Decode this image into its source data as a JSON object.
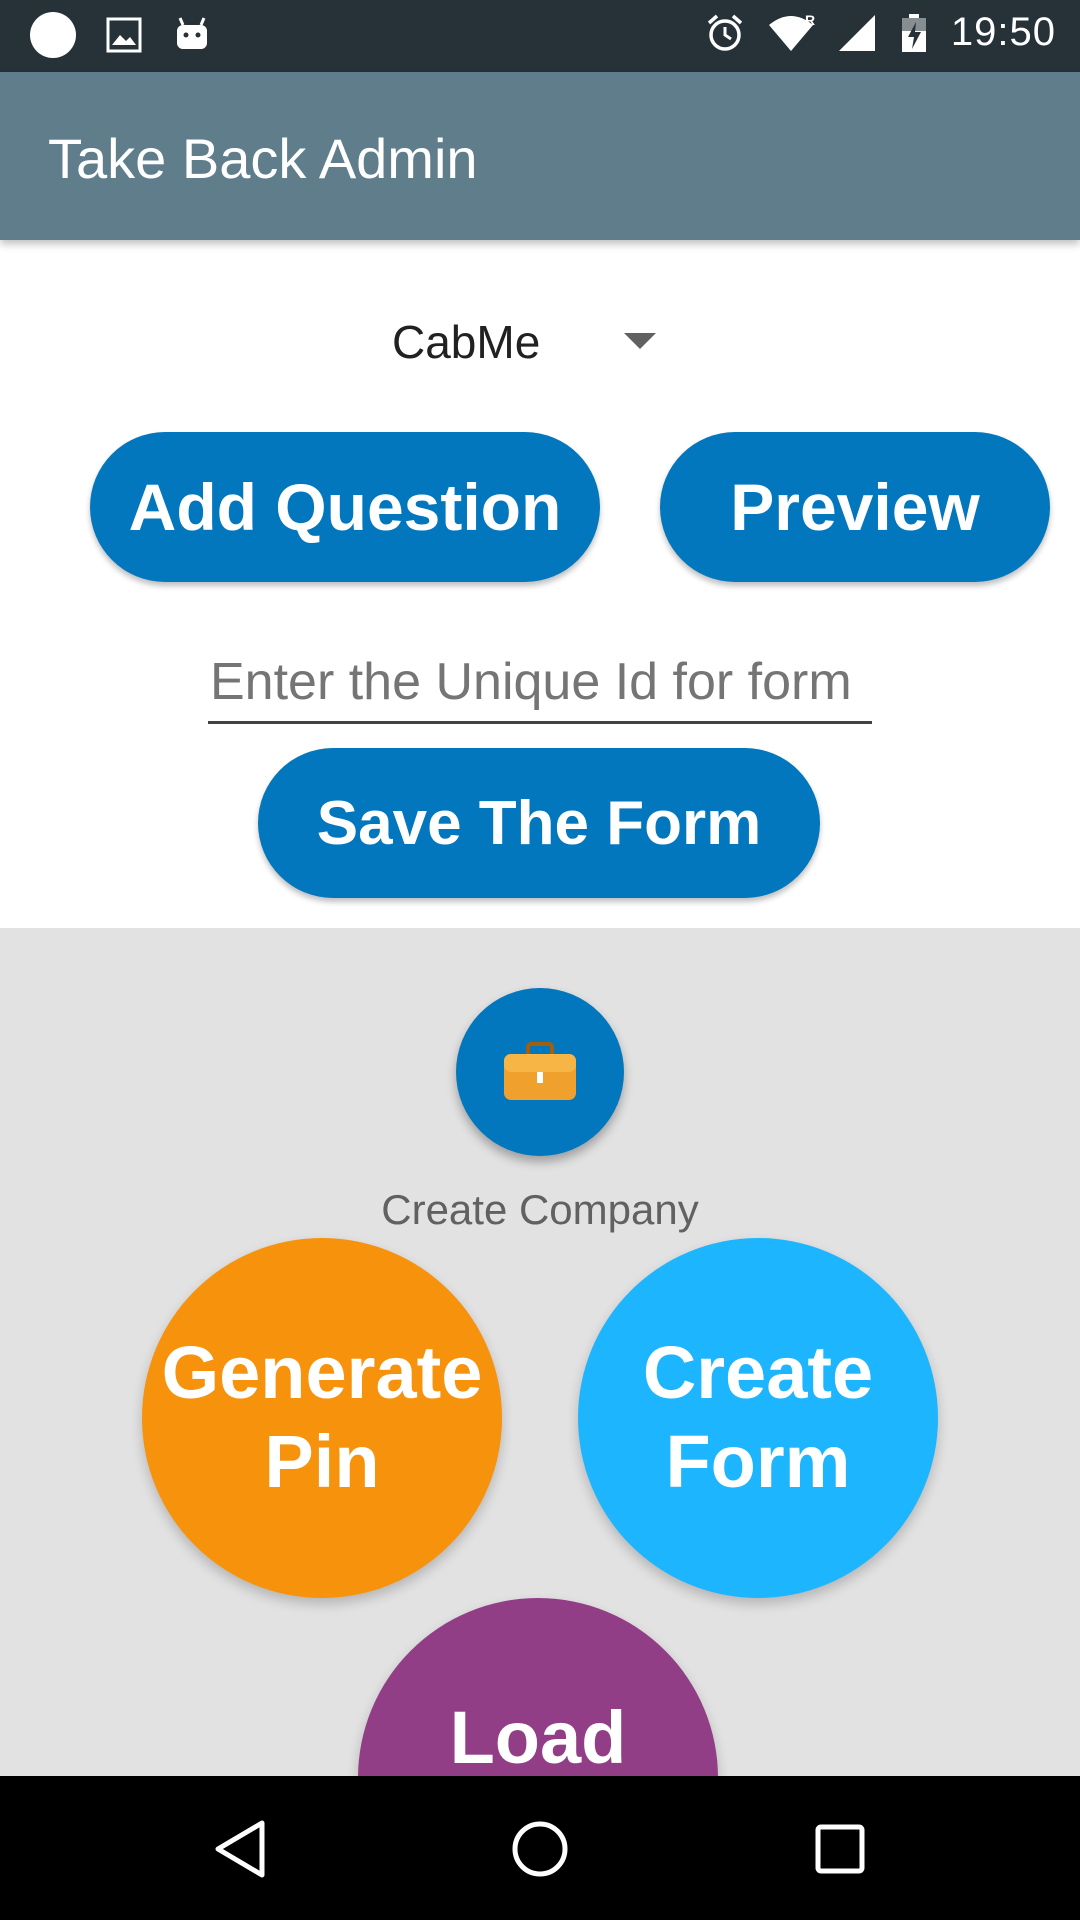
{
  "status_bar": {
    "time": "19:50",
    "left_icons": [
      "circle-notification-icon",
      "image-icon",
      "android-icon"
    ],
    "right_icons": [
      "alarm-icon",
      "wifi-icon",
      "signal-icon",
      "battery-charging-icon"
    ],
    "roaming_label": "R"
  },
  "app_bar": {
    "title": "Take Back Admin",
    "color": "#607d8b"
  },
  "company_dropdown": {
    "selected": "CabMe"
  },
  "buttons": {
    "add_question": "Add Question",
    "preview": "Preview",
    "save_form": "Save The Form",
    "color": "#0277bd"
  },
  "unique_id_input": {
    "placeholder": "Enter the Unique Id for form",
    "value": ""
  },
  "menu": {
    "fab_icon": "briefcase-icon",
    "fab_label": "Create Company",
    "items": [
      {
        "label_line1": "Generate",
        "label_line2": "Pin",
        "color": "#f7920c"
      },
      {
        "label_line1": "Create",
        "label_line2": "Form",
        "color": "#1eb5ff"
      },
      {
        "label_line1": "Load",
        "color": "#913e87"
      }
    ]
  },
  "nav_bar": {
    "icons": [
      "back-icon",
      "home-icon",
      "recents-icon"
    ]
  }
}
